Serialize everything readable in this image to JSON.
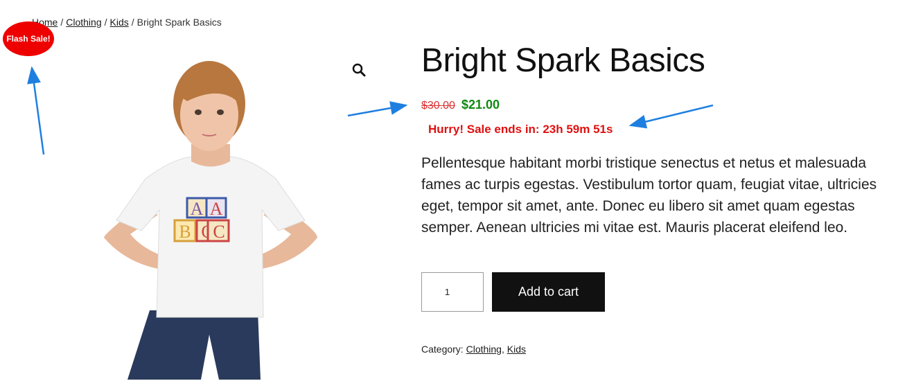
{
  "breadcrumb": {
    "home": "Home",
    "sep1": "/",
    "clothing": "Clothing",
    "sep2": "/",
    "kids": "Kids",
    "sep3": "/",
    "current": "Bright Spark Basics"
  },
  "badge": {
    "label": "Flash Sale!"
  },
  "product": {
    "title": "Bright Spark Basics",
    "old_price": "$30.00",
    "new_price": "$21.00",
    "countdown": "Hurry! Sale ends in: 23h 59m 51s",
    "description": "Pellentesque habitant morbi tristique senectus et netus et malesuada fames ac turpis egestas. Vestibulum tortor quam, feugiat vitae, ultricies eget, tempor sit amet, ante. Donec eu libero sit amet quam egestas semper. Aenean ultricies mi vitae est. Mauris placerat eleifend leo.",
    "shirt_blocks": [
      "A",
      "A",
      "B",
      "C",
      "C"
    ]
  },
  "cart": {
    "quantity": "1",
    "add_label": "Add to cart"
  },
  "category": {
    "label": "Category:",
    "items": [
      "Clothing",
      "Kids"
    ],
    "separator": ","
  },
  "colors": {
    "accent_red": "#ee0000",
    "price_green": "#118811",
    "annotation_arrow": "#1e7fe0"
  },
  "icons": {
    "zoom": "search-icon"
  }
}
